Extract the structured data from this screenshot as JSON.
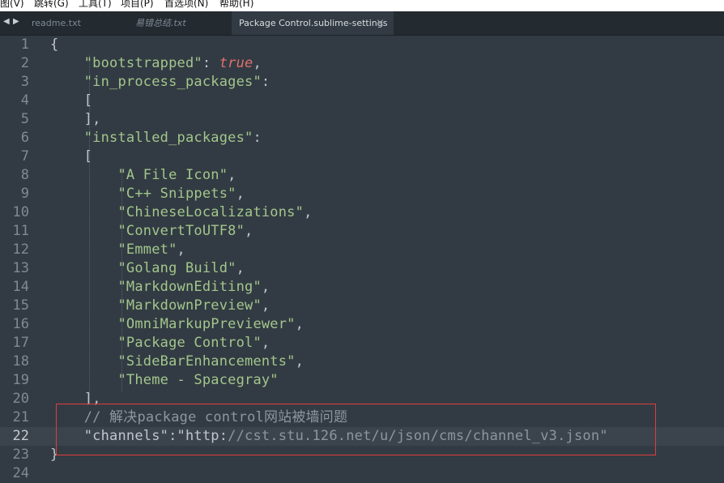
{
  "menubar": {
    "items": [
      "图(V)",
      "跳转(G)",
      "工具(T)",
      "项目(P)",
      "首选项(N)",
      "帮助(H)"
    ]
  },
  "tabbar": {
    "nav_left": "◀",
    "nav_right": "▶",
    "tabs": [
      {
        "label": "readme.txt",
        "active": false
      },
      {
        "label": "易错总结.txt",
        "active": false
      },
      {
        "label": "Package Control.sublime-settings",
        "active": true
      }
    ],
    "close_glyph": "×"
  },
  "editor": {
    "lines": [
      {
        "n": "1",
        "text": "{"
      },
      {
        "n": "2",
        "text": "    \"bootstrapped\": true,"
      },
      {
        "n": "3",
        "text": "    \"in_process_packages\":"
      },
      {
        "n": "4",
        "text": "    ["
      },
      {
        "n": "5",
        "text": "    ],"
      },
      {
        "n": "6",
        "text": "    \"installed_packages\":"
      },
      {
        "n": "7",
        "text": "    ["
      },
      {
        "n": "8",
        "text": "        \"A File Icon\","
      },
      {
        "n": "9",
        "text": "        \"C++ Snippets\","
      },
      {
        "n": "10",
        "text": "        \"ChineseLocalizations\","
      },
      {
        "n": "11",
        "text": "        \"ConvertToUTF8\","
      },
      {
        "n": "12",
        "text": "        \"Emmet\","
      },
      {
        "n": "13",
        "text": "        \"Golang Build\","
      },
      {
        "n": "14",
        "text": "        \"MarkdownEditing\","
      },
      {
        "n": "15",
        "text": "        \"MarkdownPreview\","
      },
      {
        "n": "16",
        "text": "        \"OmniMarkupPreviewer\","
      },
      {
        "n": "17",
        "text": "        \"Package Control\","
      },
      {
        "n": "18",
        "text": "        \"SideBarEnhancements\","
      },
      {
        "n": "19",
        "text": "        \"Theme - Spacegray\""
      },
      {
        "n": "20",
        "text": "    ],"
      },
      {
        "n": "21",
        "text": "    // 解决package control网站被墙问题"
      },
      {
        "n": "22",
        "text": "    \"channels\":\"http://cst.stu.126.net/u/json/cms/channel_v3.json\""
      },
      {
        "n": "23",
        "text": "}"
      },
      {
        "n": "24",
        "text": ""
      }
    ],
    "highlighted_line": "22"
  },
  "colors": {
    "editor_bg": "#323b43",
    "string": "#a3c68c",
    "keyword": "#e0706d",
    "comment": "#8c96a0",
    "annotation": "#e03d3d"
  }
}
